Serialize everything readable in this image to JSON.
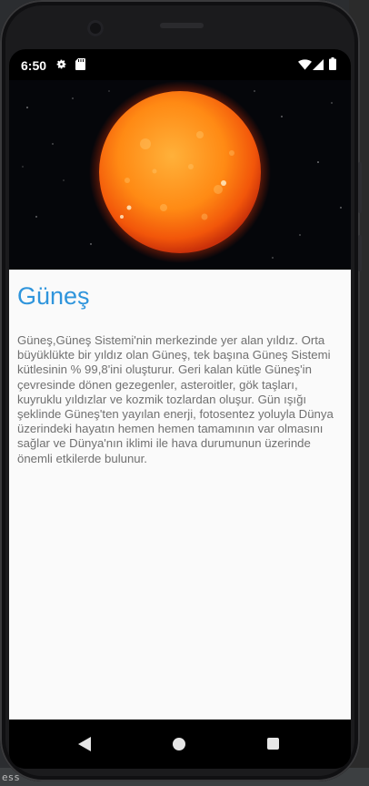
{
  "status_bar": {
    "time": "6:50",
    "icons": [
      "gear-icon",
      "sdcard-icon",
      "wifi-icon",
      "signal-icon",
      "battery-icon"
    ]
  },
  "hero": {
    "image": "sun-image"
  },
  "article": {
    "title": "Güneş",
    "body": "Güneş,Güneş Sistemi'nin merkezinde yer alan yıldız. Orta büyüklükte bir yıldız olan Güneş, tek başına Güneş Sistemi kütlesinin % 99,8'ini oluşturur. Geri kalan kütle Güneş'in çevresinde dönen gezegenler, asteroitler, gök taşları, kuyruklu yıldızlar ve kozmik tozlardan oluşur. Gün ışığı şeklinde Güneş'ten yayılan enerji, fotosentez yoluyla Dünya üzerindeki hayatın hemen hemen tamamının var olmasını sağlar ve Dünya'nın iklimi ile hava durumunun üzerinde önemli etkilerde bulunur."
  },
  "navigation": {
    "icons": [
      "back-icon",
      "home-icon",
      "recents-icon"
    ]
  },
  "ide": {
    "bottom_text": "ess"
  },
  "colors": {
    "title": "#2f95dc",
    "body_text": "#707070",
    "content_bg": "#fafafa",
    "sun": "#ff7a10"
  }
}
